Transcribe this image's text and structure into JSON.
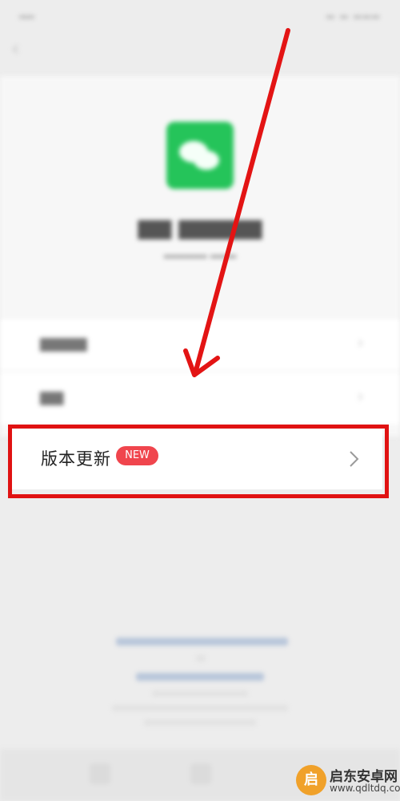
{
  "menu": {
    "update_label": "版本更新",
    "update_badge": "NEW"
  },
  "icons": {
    "back": "back-arrow-icon",
    "chevron": "chevron-right-icon",
    "annotation_arrow": "annotation-arrow"
  },
  "colors": {
    "highlight": "#e01212",
    "badge": "#f0454d",
    "logo": "#25c45a"
  },
  "watermark": {
    "title": "启东安卓网",
    "url": "www.qdltdq.com",
    "logo_char": "启"
  }
}
